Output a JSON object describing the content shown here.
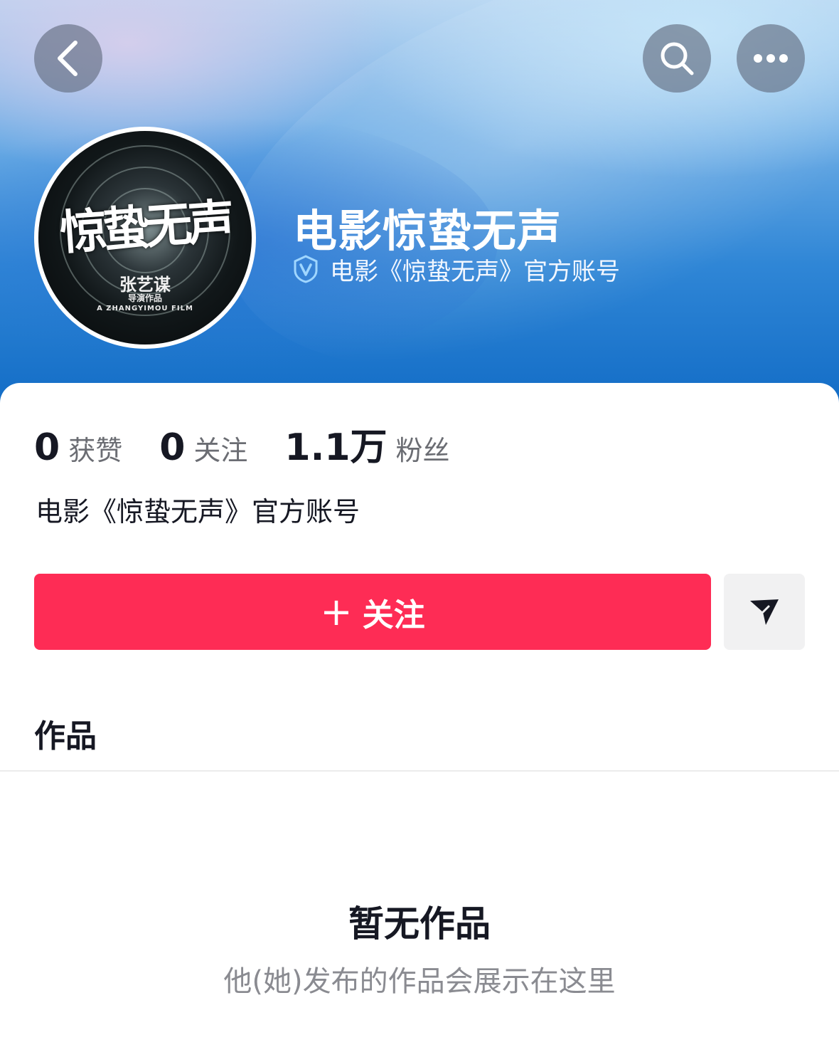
{
  "header": {
    "back_icon": "chevron-left-icon",
    "search_icon": "search-icon",
    "more_icon": "more-horizontal-icon"
  },
  "avatar": {
    "title_text": "惊蛰无声",
    "director_text": "张艺谋",
    "sub_text": "导演作品",
    "film_text": "A ZHANGYIMOU FILM"
  },
  "profile": {
    "name": "电影惊蛰无声",
    "verify_icon": "verified-badge-icon",
    "verification": "电影《惊蛰无声》官方账号"
  },
  "stats": [
    {
      "value": "0",
      "label": "获赞"
    },
    {
      "value": "0",
      "label": "关注"
    },
    {
      "value": "1.1万",
      "label": "粉丝"
    }
  ],
  "bio": "电影《惊蛰无声》官方账号",
  "actions": {
    "follow_plus": "+",
    "follow_label": "关注",
    "share_icon": "send-icon"
  },
  "tabs": {
    "works": "作品"
  },
  "empty_state": {
    "title": "暂无作品",
    "subtitle": "他(她)发布的作品会展示在这里"
  },
  "colors": {
    "accent": "#fe2c55",
    "banner_blue": "#0f69c4",
    "text_primary": "#161823",
    "text_secondary": "#8a8b91"
  }
}
